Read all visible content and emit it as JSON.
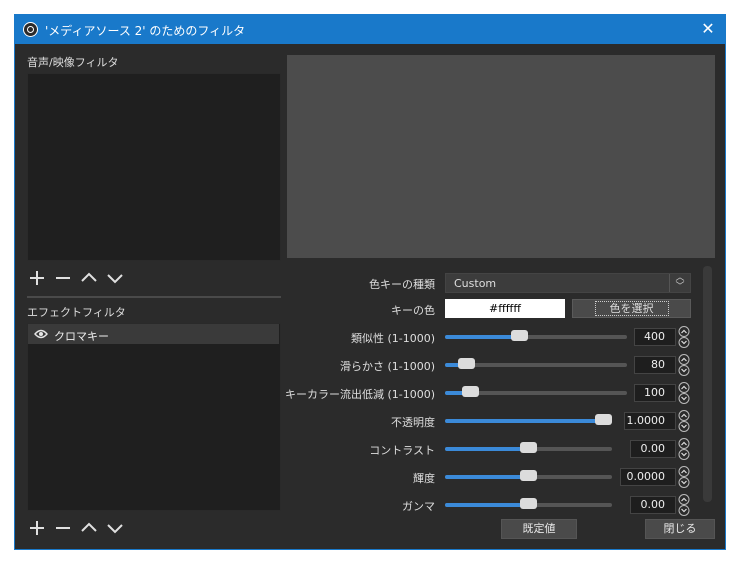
{
  "window": {
    "title": "'メディアソース 2' のためのフィルタ"
  },
  "audio_video": {
    "label": "音声/映像フィルタ"
  },
  "effects": {
    "label": "エフェクトフィルタ",
    "items": [
      {
        "name": "クロマキー"
      }
    ]
  },
  "properties": {
    "key_type": {
      "label": "色キーの種類",
      "value": "Custom"
    },
    "key_color": {
      "label": "キーの色",
      "value": "#ffffff",
      "button": "色を選択"
    },
    "sliders": [
      {
        "label": "類似性 (1-1000)",
        "value": "400",
        "fraction": 0.4
      },
      {
        "label": "滑らかさ (1-1000)",
        "value": "80",
        "fraction": 0.08
      },
      {
        "label": "キーカラー流出低減 (1-1000)",
        "value": "100",
        "fraction": 0.1
      },
      {
        "label": "不透明度",
        "value": "1.0000",
        "fraction": 1.0
      },
      {
        "label": "コントラスト",
        "value": "0.00",
        "fraction": 0.5
      },
      {
        "label": "輝度",
        "value": "0.0000",
        "fraction": 0.5
      },
      {
        "label": "ガンマ",
        "value": "0.00",
        "fraction": 0.5
      }
    ]
  },
  "footer": {
    "defaults": "既定値",
    "close": "閉じる"
  },
  "colors": {
    "accent": "#1979ca",
    "slider": "#3b8ad9",
    "background": "#2b2b2b"
  }
}
